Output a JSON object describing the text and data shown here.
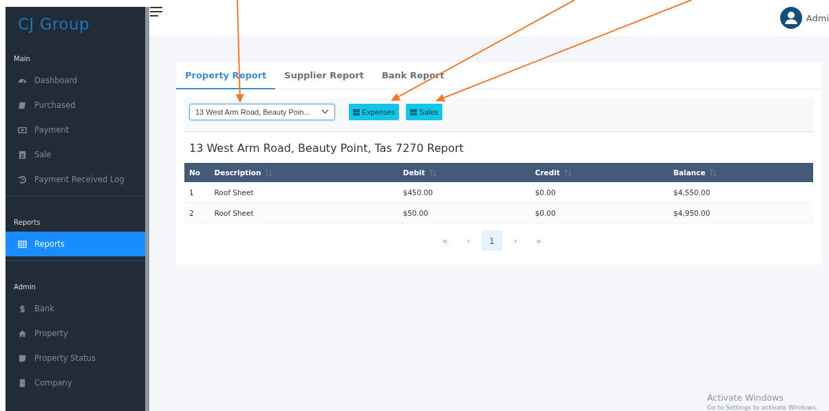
{
  "sidebar": {
    "logo": "CJ Group",
    "sections": [
      {
        "label": "Main",
        "items": [
          {
            "label": "Dashboard",
            "kind": "gauge",
            "selected": false
          },
          {
            "label": "Purchased",
            "kind": "book",
            "selected": false
          },
          {
            "label": "Payment",
            "kind": "money",
            "selected": false
          },
          {
            "label": "Sale",
            "kind": "calculator",
            "selected": false
          },
          {
            "label": "Payment Received Log",
            "kind": "history",
            "selected": false
          }
        ]
      },
      {
        "label": "Reports",
        "items": [
          {
            "label": "Reports",
            "kind": "table",
            "selected": true
          }
        ]
      },
      {
        "label": "Admin",
        "items": [
          {
            "label": "Bank",
            "kind": "dollar",
            "selected": false
          },
          {
            "label": "Property",
            "kind": "home",
            "selected": false
          },
          {
            "label": "Property Status",
            "kind": "note",
            "selected": false
          },
          {
            "label": "Company",
            "kind": "building",
            "selected": false
          }
        ]
      }
    ]
  },
  "header": {
    "user": "Admi"
  },
  "tabs": [
    {
      "label": "Property Report",
      "selected": true
    },
    {
      "label": "Supplier Report",
      "selected": false
    },
    {
      "label": "Bank Report",
      "selected": false
    }
  ],
  "property_select": {
    "value": "13 West Arm Road, Beauty Poin..."
  },
  "buttons": [
    "Expenses",
    "Sales"
  ],
  "report_title": "13 West Arm Road, Beauty Point, Tas 7270 Report",
  "table": {
    "columns": [
      {
        "label": "No",
        "sortable": false
      },
      {
        "label": "Description",
        "sortable": true
      },
      {
        "label": "Debit",
        "sortable": true
      },
      {
        "label": "Credit",
        "sortable": true
      },
      {
        "label": "Balance",
        "sortable": true
      }
    ],
    "rows": [
      [
        "1",
        "Roof Sheet",
        "$450.00",
        "$0.00",
        "$4,550.00"
      ],
      [
        "2",
        "Roof Sheet",
        "$50.00",
        "$0.00",
        "$4,950.00"
      ]
    ]
  },
  "pagination": [
    {
      "label": "«",
      "selected": false
    },
    {
      "label": "‹",
      "selected": false
    },
    {
      "label": "1",
      "selected": true
    },
    {
      "label": "›",
      "selected": false
    },
    {
      "label": "»",
      "selected": false
    }
  ],
  "windows_notice": {
    "title": "Activate Windows",
    "subtitle": "Go to Settings to activate Windows."
  }
}
